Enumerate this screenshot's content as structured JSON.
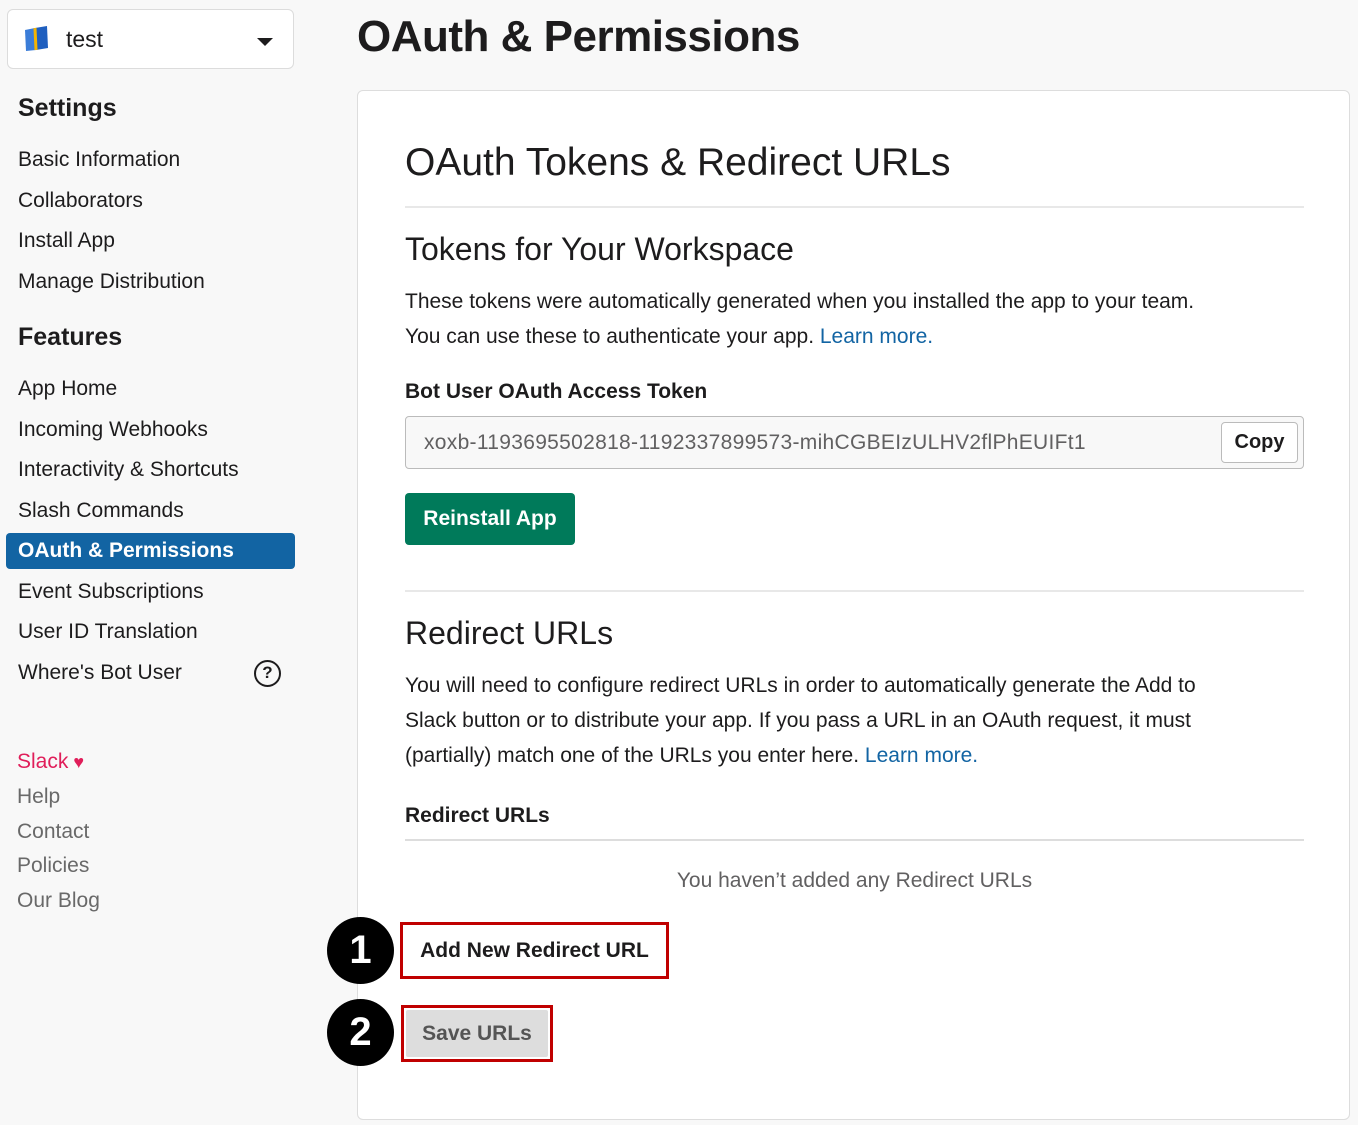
{
  "app_switcher": {
    "app_name": "test"
  },
  "sidebar": {
    "settings_heading": "Settings",
    "settings_items": [
      {
        "label": "Basic Information"
      },
      {
        "label": "Collaborators"
      },
      {
        "label": "Install App"
      },
      {
        "label": "Manage Distribution"
      }
    ],
    "features_heading": "Features",
    "features_items": [
      {
        "label": "App Home"
      },
      {
        "label": "Incoming Webhooks"
      },
      {
        "label": "Interactivity & Shortcuts"
      },
      {
        "label": "Slash Commands"
      },
      {
        "label": "OAuth & Permissions",
        "active": true
      },
      {
        "label": "Event Subscriptions"
      },
      {
        "label": "User ID Translation"
      },
      {
        "label": "Where's Bot User",
        "help_icon": "?"
      }
    ],
    "footer_items": [
      {
        "label": "Slack"
      },
      {
        "label": "Help"
      },
      {
        "label": "Contact"
      },
      {
        "label": "Policies"
      },
      {
        "label": "Our Blog"
      }
    ],
    "heart_glyph": "♥"
  },
  "page": {
    "title": "OAuth & Permissions"
  },
  "card": {
    "title": "OAuth Tokens & Redirect URLs",
    "tokens": {
      "heading": "Tokens for Your Workspace",
      "description_line1": "These tokens were automatically generated when you installed the app to your team.",
      "description_line2": "You can use these to authenticate your app.",
      "learn_more": "Learn more.",
      "bot_token_label": "Bot User OAuth Access Token",
      "bot_token_value": "xoxb-1193695502818-1192337899573-mihCGBEIzULHV2flPhEUIFt1",
      "copy_label": "Copy",
      "reinstall_label": "Reinstall App"
    },
    "redirect": {
      "heading": "Redirect URLs",
      "description_line1": "You will need to configure redirect URLs in order to automatically generate the Add to",
      "description_line2": "Slack button or to distribute your app. If you pass a URL in an OAuth request, it must",
      "description_line3": "(partially) match one of the URLs you enter here.",
      "learn_more": "Learn more.",
      "list_label": "Redirect URLs",
      "empty_message": "You haven’t added any Redirect URLs",
      "add_label": "Add New Redirect URL",
      "save_label": "Save URLs"
    }
  },
  "annotations": [
    {
      "label": "1"
    },
    {
      "label": "2"
    }
  ],
  "colors": {
    "active_nav": "#1264a3",
    "link": "#1264a3",
    "reinstall_button": "#007a5a",
    "slack_footer": "#e01e5a",
    "annotation_outline": "#c00000"
  }
}
